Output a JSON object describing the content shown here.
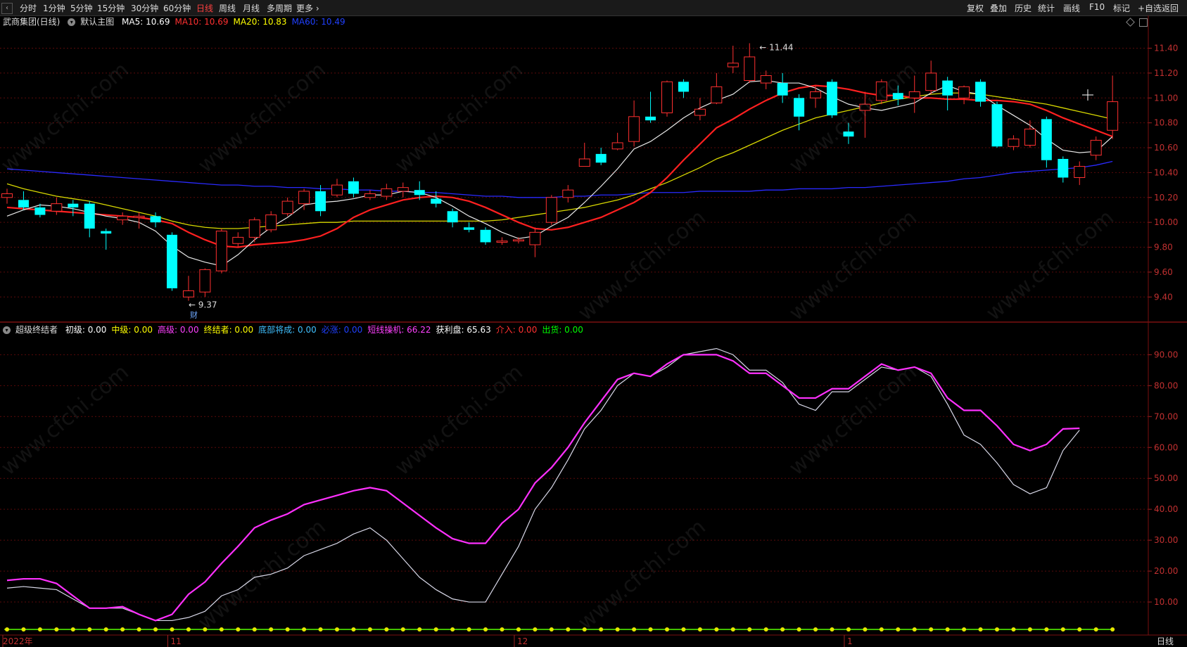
{
  "toolbar": {
    "left": [
      "分时",
      "1分钟",
      "5分钟",
      "15分钟",
      "30分钟",
      "60分钟",
      "日线",
      "周线",
      "月线",
      "多周期",
      "更多 ›"
    ],
    "active": "日线",
    "right": [
      "复权",
      "叠加",
      "历史",
      "统计",
      "画线",
      "F10",
      "标记",
      "+自选",
      "返回"
    ]
  },
  "main_legend": {
    "name": "武商集团(日线)",
    "template": "默认主图",
    "ma": [
      {
        "label": "MA5: 10.69",
        "color": "#ffffff"
      },
      {
        "label": "MA10: 10.69",
        "color": "#ff3030"
      },
      {
        "label": "MA20: 10.83",
        "color": "#ffff00"
      },
      {
        "label": "MA60: 10.49",
        "color": "#2040ff"
      }
    ]
  },
  "sub_legend": {
    "name": "超级终结者",
    "items": [
      {
        "label": "初级: 0.00",
        "color": "#ffffff"
      },
      {
        "label": "中级: 0.00",
        "color": "#ffff00"
      },
      {
        "label": "高级: 0.00",
        "color": "#ff40ff"
      },
      {
        "label": "终结者: 0.00",
        "color": "#ffff00"
      },
      {
        "label": "底部将成: 0.00",
        "color": "#40c0ff"
      },
      {
        "label": "必涨: 0.00",
        "color": "#2040ff"
      },
      {
        "label": "短线操机: 66.22",
        "color": "#ff40ff"
      },
      {
        "label": "获利盘: 65.63",
        "color": "#ffffff"
      },
      {
        "label": "介入: 0.00",
        "color": "#ff3030"
      },
      {
        "label": "出货: 0.00",
        "color": "#00ff00"
      }
    ]
  },
  "price_axis": {
    "ticks": [
      "11.40",
      "11.20",
      "11.00",
      "10.80",
      "10.60",
      "10.40",
      "10.20",
      "10.00",
      "9.80",
      "9.60",
      "9.40"
    ],
    "values": [
      11.4,
      11.2,
      11.0,
      10.8,
      10.6,
      10.4,
      10.2,
      10.0,
      9.8,
      9.6,
      9.4
    ],
    "min": 9.3,
    "max": 11.55
  },
  "ind_axis": {
    "ticks": [
      "90.00",
      "80.00",
      "70.00",
      "60.00",
      "50.00",
      "40.00",
      "30.00",
      "20.00",
      "10.00"
    ],
    "values": [
      90,
      80,
      70,
      60,
      50,
      40,
      30,
      20,
      10
    ],
    "min": 0,
    "max": 96
  },
  "date_labels": [
    {
      "text": "2022年",
      "index": 0
    },
    {
      "text": "11",
      "index": 10
    },
    {
      "text": "12",
      "index": 31
    },
    {
      "text": "1",
      "index": 51
    }
  ],
  "bottom_right_label": "日线",
  "annotations": {
    "high": "11.44",
    "low": "9.37",
    "low_marker": "财"
  },
  "watermark": "www.cfchi.com",
  "chart_data": {
    "type": "candlestick",
    "candles": [
      [
        10.2,
        10.23,
        10.27,
        10.15
      ],
      [
        10.18,
        10.12,
        10.25,
        10.1
      ],
      [
        10.12,
        10.06,
        10.15,
        10.04
      ],
      [
        10.09,
        10.15,
        10.2,
        10.06
      ],
      [
        10.15,
        10.12,
        10.18,
        10.05
      ],
      [
        10.15,
        9.95,
        10.17,
        9.88
      ],
      [
        9.93,
        9.91,
        9.95,
        9.78
      ],
      [
        10.02,
        10.05,
        10.08,
        9.98
      ],
      [
        10.04,
        10.05,
        10.08,
        9.95
      ],
      [
        10.05,
        10.0,
        10.08,
        9.96
      ],
      [
        9.9,
        9.47,
        9.92,
        9.45
      ],
      [
        9.4,
        9.45,
        9.57,
        9.37
      ],
      [
        9.44,
        9.62,
        9.63,
        9.4
      ],
      [
        9.61,
        9.93,
        9.95,
        9.59
      ],
      [
        9.83,
        9.88,
        9.92,
        9.8
      ],
      [
        9.88,
        10.02,
        10.04,
        9.84
      ],
      [
        9.94,
        10.06,
        10.09,
        9.92
      ],
      [
        10.07,
        10.17,
        10.2,
        10.05
      ],
      [
        10.15,
        10.25,
        10.27,
        10.1
      ],
      [
        10.25,
        10.09,
        10.3,
        10.05
      ],
      [
        10.22,
        10.3,
        10.35,
        10.2
      ],
      [
        10.33,
        10.23,
        10.36,
        10.2
      ],
      [
        10.2,
        10.23,
        10.26,
        10.18
      ],
      [
        10.21,
        10.27,
        10.31,
        10.18
      ],
      [
        10.25,
        10.28,
        10.32,
        10.2
      ],
      [
        10.26,
        10.22,
        10.33,
        10.18
      ],
      [
        10.19,
        10.15,
        10.25,
        10.12
      ],
      [
        10.09,
        10.0,
        10.11,
        9.96
      ],
      [
        9.96,
        9.94,
        10.0,
        9.92
      ],
      [
        9.94,
        9.84,
        9.96,
        9.82
      ],
      [
        9.84,
        9.85,
        9.88,
        9.82
      ],
      [
        9.85,
        9.86,
        9.88,
        9.83
      ],
      [
        9.82,
        9.92,
        9.96,
        9.72
      ],
      [
        10.0,
        10.2,
        10.22,
        9.98
      ],
      [
        10.2,
        10.26,
        10.3,
        10.16
      ],
      [
        10.45,
        10.51,
        10.64,
        10.45
      ],
      [
        10.55,
        10.48,
        10.6,
        10.46
      ],
      [
        10.59,
        10.64,
        10.72,
        10.58
      ],
      [
        10.65,
        10.85,
        10.98,
        10.61
      ],
      [
        10.85,
        10.82,
        11.05,
        10.8
      ],
      [
        10.88,
        11.13,
        11.14,
        10.85
      ],
      [
        11.13,
        11.05,
        11.15,
        11.0
      ],
      [
        10.86,
        10.91,
        11.0,
        10.82
      ],
      [
        10.96,
        11.09,
        11.2,
        10.95
      ],
      [
        11.25,
        11.28,
        11.42,
        11.2
      ],
      [
        11.14,
        11.33,
        11.44,
        11.12
      ],
      [
        11.12,
        11.18,
        11.22,
        11.07
      ],
      [
        11.12,
        11.02,
        11.2,
        10.96
      ],
      [
        11.0,
        10.85,
        11.03,
        10.74
      ],
      [
        11.0,
        11.05,
        11.1,
        10.92
      ],
      [
        11.13,
        10.86,
        11.15,
        10.84
      ],
      [
        10.73,
        10.69,
        10.8,
        10.63
      ],
      [
        10.9,
        10.95,
        11.05,
        10.68
      ],
      [
        10.98,
        11.13,
        11.15,
        10.95
      ],
      [
        11.04,
        10.99,
        11.1,
        10.94
      ],
      [
        11.0,
        11.05,
        11.18,
        10.88
      ],
      [
        11.06,
        11.2,
        11.3,
        11.03
      ],
      [
        11.14,
        11.02,
        11.17,
        10.9
      ],
      [
        11.0,
        11.09,
        11.1,
        10.95
      ],
      [
        11.13,
        10.97,
        11.15,
        10.93
      ],
      [
        10.95,
        10.61,
        10.97,
        10.6
      ],
      [
        10.61,
        10.67,
        10.7,
        10.58
      ],
      [
        10.62,
        10.75,
        10.82,
        10.6
      ],
      [
        10.83,
        10.5,
        10.85,
        10.44
      ],
      [
        10.51,
        10.36,
        10.53,
        10.32
      ],
      [
        10.36,
        10.45,
        10.49,
        10.3
      ],
      [
        10.54,
        10.66,
        10.69,
        10.5
      ],
      [
        10.74,
        10.97,
        11.18,
        10.67
      ]
    ],
    "ma5": [
      10.05,
      10.1,
      10.14,
      10.13,
      10.11,
      10.08,
      10.05,
      10.03,
      10.0,
      9.93,
      9.81,
      9.72,
      9.68,
      9.65,
      9.74,
      9.86,
      9.96,
      10.04,
      10.14,
      10.16,
      10.17,
      10.19,
      10.22,
      10.22,
      10.25,
      10.24,
      10.2,
      10.13,
      10.05,
      9.99,
      9.92,
      9.87,
      9.89,
      9.97,
      10.04,
      10.16,
      10.29,
      10.43,
      10.59,
      10.65,
      10.74,
      10.84,
      10.92,
      10.98,
      11.03,
      11.13,
      11.14,
      11.12,
      11.12,
      11.08,
      11.01,
      10.95,
      10.92,
      10.9,
      10.93,
      10.96,
      11.04,
      11.1,
      11.05,
      11.03,
      10.94,
      10.86,
      10.78,
      10.67,
      10.58,
      10.56,
      10.57,
      10.69
    ],
    "ma10": [
      10.12,
      10.11,
      10.1,
      10.09,
      10.08,
      10.07,
      10.06,
      10.05,
      10.04,
      10.02,
      9.99,
      9.92,
      9.86,
      9.81,
      9.8,
      9.82,
      9.83,
      9.84,
      9.86,
      9.89,
      9.95,
      10.04,
      10.1,
      10.14,
      10.18,
      10.2,
      10.21,
      10.2,
      10.17,
      10.12,
      10.06,
      10.0,
      9.95,
      9.94,
      9.96,
      10.0,
      10.04,
      10.1,
      10.16,
      10.24,
      10.36,
      10.5,
      10.63,
      10.76,
      10.83,
      10.91,
      10.98,
      11.04,
      11.08,
      11.1,
      11.09,
      11.07,
      11.04,
      11.02,
      11.02,
      11.0,
      11.0,
      10.99,
      10.99,
      10.98,
      10.98,
      10.97,
      10.95,
      10.9,
      10.84,
      10.79,
      10.74,
      10.69
    ],
    "ma20": [
      10.31,
      10.27,
      10.24,
      10.21,
      10.19,
      10.17,
      10.14,
      10.11,
      10.08,
      10.05,
      10.01,
      9.98,
      9.96,
      9.95,
      9.95,
      9.96,
      9.97,
      9.98,
      9.99,
      10.0,
      10.0,
      10.01,
      10.01,
      10.01,
      10.01,
      10.01,
      10.01,
      10.01,
      10.01,
      10.01,
      10.02,
      10.04,
      10.06,
      10.08,
      10.1,
      10.12,
      10.15,
      10.18,
      10.22,
      10.27,
      10.32,
      10.38,
      10.44,
      10.51,
      10.56,
      10.62,
      10.68,
      10.74,
      10.79,
      10.84,
      10.87,
      10.9,
      10.93,
      10.96,
      10.99,
      11.01,
      11.03,
      11.04,
      11.04,
      11.03,
      11.01,
      10.99,
      10.97,
      10.95,
      10.92,
      10.89,
      10.86,
      10.83
    ],
    "ma60": [
      10.43,
      10.42,
      10.41,
      10.4,
      10.39,
      10.38,
      10.37,
      10.36,
      10.35,
      10.34,
      10.33,
      10.32,
      10.31,
      10.3,
      10.3,
      10.29,
      10.29,
      10.28,
      10.28,
      10.27,
      10.27,
      10.26,
      10.26,
      10.25,
      10.25,
      10.24,
      10.24,
      10.23,
      10.22,
      10.21,
      10.21,
      10.2,
      10.2,
      10.2,
      10.21,
      10.21,
      10.22,
      10.22,
      10.23,
      10.24,
      10.24,
      10.24,
      10.25,
      10.25,
      10.25,
      10.25,
      10.26,
      10.26,
      10.27,
      10.27,
      10.27,
      10.28,
      10.28,
      10.29,
      10.3,
      10.31,
      10.32,
      10.33,
      10.35,
      10.36,
      10.38,
      10.4,
      10.41,
      10.42,
      10.43,
      10.44,
      10.46,
      10.49
    ],
    "short_line": [
      17,
      17.5,
      17.5,
      16,
      12,
      8,
      8,
      8.5,
      6,
      4,
      6,
      12.5,
      16.5,
      22.5,
      28,
      34,
      36.5,
      38.5,
      41.5,
      43,
      44.5,
      46,
      47,
      46,
      42,
      38,
      34,
      30.5,
      29,
      29,
      35.5,
      40,
      48.5,
      53.5,
      60,
      68,
      75,
      82,
      84,
      83,
      87,
      90,
      90,
      90,
      88,
      84,
      84,
      80,
      76,
      76,
      79,
      79,
      83,
      87,
      85,
      86,
      84,
      76,
      72,
      72,
      67,
      61,
      59,
      61,
      66,
      66.2
    ],
    "profit": [
      14.5,
      15,
      14.5,
      14,
      11,
      8,
      8,
      8,
      6,
      4,
      4,
      5,
      7,
      12,
      14,
      18,
      19,
      21,
      25,
      27,
      29,
      32,
      34,
      30,
      24,
      18,
      14,
      11,
      10,
      10,
      19,
      28,
      40,
      47,
      56,
      66,
      72,
      80,
      84,
      83,
      86,
      90,
      91,
      92,
      90,
      85,
      85,
      81,
      74,
      72,
      78,
      78,
      82,
      86,
      85,
      86,
      83,
      74,
      64,
      61,
      55,
      48,
      45,
      47,
      59,
      65.6
    ]
  }
}
